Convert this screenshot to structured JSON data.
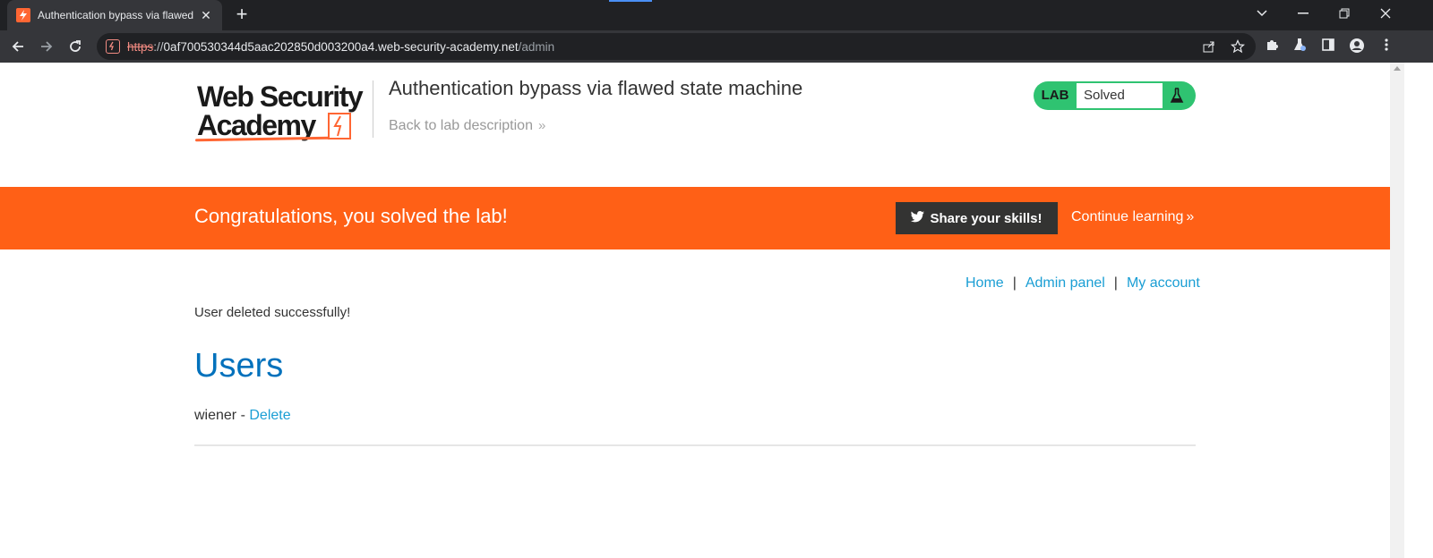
{
  "browser": {
    "tab_title": "Authentication bypass via flawed",
    "tab_close": "✕",
    "new_tab": "+",
    "url_https": "https",
    "url_sep": "://",
    "url_host": "0af700530344d5aac202850d003200a4.web-security-academy.net",
    "url_path": "/admin",
    "accent_warning": "#f28b82"
  },
  "header": {
    "logo_line1": "Web Security",
    "logo_line2": "Academy",
    "lab_title": "Authentication bypass via flawed state machine",
    "back_link": "Back to lab description",
    "lab_badge": "LAB",
    "lab_status": "Solved",
    "status_color": "#2fc371"
  },
  "banner": {
    "text": "Congratulations, you solved the lab!",
    "share_label": "Share your skills!",
    "continue_label": "Continue learning",
    "bg_color": "#ff6016"
  },
  "nav": {
    "home": "Home",
    "admin": "Admin panel",
    "account": "My account",
    "sep": "|"
  },
  "main": {
    "message": "User deleted successfully!",
    "heading": "Users",
    "users": [
      {
        "name": "wiener",
        "dash": " - ",
        "action": "Delete"
      }
    ]
  }
}
